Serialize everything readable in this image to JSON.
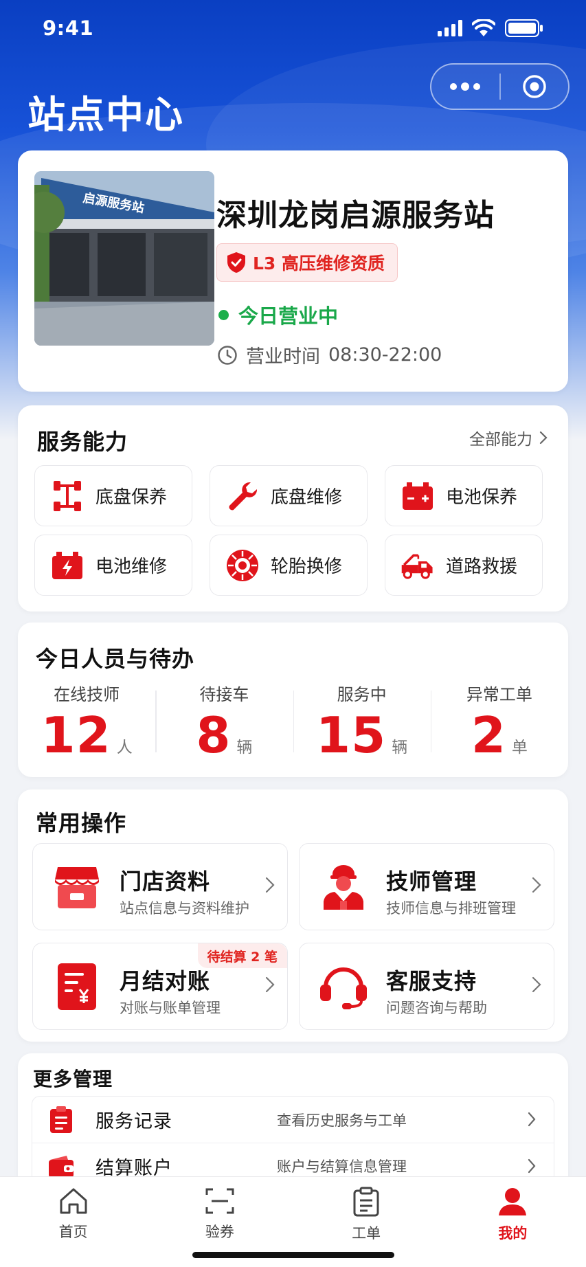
{
  "status_bar": {
    "time": "9:41"
  },
  "header": {
    "title": "站点中心"
  },
  "station": {
    "name": "深圳龙岗启源服务站",
    "photo_sign": "启源服务站",
    "qualification": "L3 高压维修资质",
    "open_status": "今日营业中",
    "hours_label": "营业时间",
    "hours_value": "08:30-22:00"
  },
  "services": {
    "title": "服务能力",
    "see_all": "全部能力",
    "items": [
      {
        "label": "底盘保养",
        "icon": "chassis-icon"
      },
      {
        "label": "底盘维修",
        "icon": "wrench-icon"
      },
      {
        "label": "电池保养",
        "icon": "battery-icon"
      },
      {
        "label": "电池维修",
        "icon": "battery-bolt-icon"
      },
      {
        "label": "轮胎换修",
        "icon": "tire-icon"
      },
      {
        "label": "道路救援",
        "icon": "tow-truck-icon"
      }
    ]
  },
  "staff": {
    "title": "今日人员与待办",
    "stats": [
      {
        "label": "在线技师",
        "value": "12",
        "unit": "人"
      },
      {
        "label": "待接车",
        "value": "8",
        "unit": "辆"
      },
      {
        "label": "服务中",
        "value": "15",
        "unit": "辆"
      },
      {
        "label": "异常工单",
        "value": "2",
        "unit": "单"
      }
    ]
  },
  "ops": {
    "title": "常用操作",
    "items": [
      {
        "title": "门店资料",
        "sub": "站点信息与资料维护",
        "icon": "store-icon",
        "tag": ""
      },
      {
        "title": "技师管理",
        "sub": "技师信息与排班管理",
        "icon": "technician-icon",
        "tag": ""
      },
      {
        "title": "月结对账",
        "sub": "对账与账单管理",
        "icon": "invoice-icon",
        "tag": "待结算 2 笔"
      },
      {
        "title": "客服支持",
        "sub": "问题咨询与帮助",
        "icon": "headset-icon",
        "tag": ""
      }
    ]
  },
  "more": {
    "title": "更多管理",
    "rows": [
      {
        "title": "服务记录",
        "desc": "查看历史服务与工单",
        "icon": "clipboard-icon"
      },
      {
        "title": "结算账户",
        "desc": "账户与结算信息管理",
        "icon": "wallet-icon"
      }
    ]
  },
  "tabbar": {
    "tabs": [
      {
        "label": "首页",
        "icon": "home-icon"
      },
      {
        "label": "验券",
        "icon": "scan-icon"
      },
      {
        "label": "工单",
        "icon": "clipboard-icon"
      },
      {
        "label": "我的",
        "icon": "user-icon"
      }
    ],
    "active": "我的"
  },
  "colors": {
    "accent": "#e0141b",
    "brand_blue": "#0a3fc2",
    "success": "#1aa84a"
  }
}
